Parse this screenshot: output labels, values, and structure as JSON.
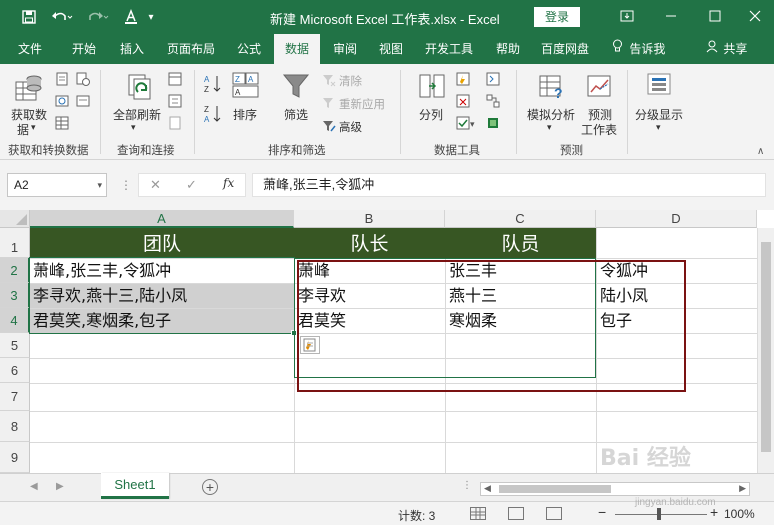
{
  "window": {
    "title": "新建 Microsoft Excel 工作表.xlsx  -  Excel",
    "login_label": "登录"
  },
  "tabs": [
    "文件",
    "开始",
    "插入",
    "页面布局",
    "公式",
    "数据",
    "审阅",
    "视图",
    "开发工具",
    "帮助",
    "百度网盘"
  ],
  "active_tab": "数据",
  "tell_me": "告诉我",
  "share": "共享",
  "ribbon": {
    "get_data": {
      "line1": "获取数",
      "line2": "据"
    },
    "group_get": "获取和转换数据",
    "refresh_all": "全部刷新",
    "group_query": "查询和连接",
    "sort_az": "A→Z",
    "sort": "排序",
    "filter": "筛选",
    "clear": "清除",
    "reapply": "重新应用",
    "advanced": "高级",
    "group_sort": "排序和筛选",
    "split": "分列",
    "group_tools": "数据工具",
    "what_if": "模拟分析",
    "forecast_line1": "预测",
    "forecast_line2": "工作表",
    "group_forecast": "预测",
    "outline": "分级显示"
  },
  "formula_bar": {
    "name_box": "A2",
    "fx": "fx",
    "content": "萧峰,张三丰,令狐冲"
  },
  "columns": [
    "A",
    "B",
    "C",
    "D"
  ],
  "selected_column": "A",
  "rows": [
    "1",
    "2",
    "3",
    "4",
    "5",
    "6",
    "7",
    "8",
    "9"
  ],
  "sheet": {
    "headers": {
      "a": "团队",
      "b": "队长",
      "c": "队员"
    },
    "a_values": [
      "萧峰,张三丰,令狐冲",
      "李寻欢,燕十三,陆小凤",
      "君莫笑,寒烟柔,包子"
    ],
    "b_values": [
      "萧峰",
      "李寻欢",
      "君莫笑"
    ],
    "c_values": [
      "张三丰",
      "燕十三",
      "寒烟柔"
    ],
    "d_values": [
      "令狐冲",
      "陆小凤",
      "包子"
    ]
  },
  "sheet_tabs": [
    "Sheet1"
  ],
  "status": {
    "count": "计数: 3",
    "zoom": "100%"
  },
  "watermark": {
    "text": "Bai 经验",
    "sub": "jingyan.baidu.com"
  },
  "colors": {
    "accent": "#217346",
    "header_fill": "#375623",
    "red_box": "#7a1212"
  }
}
